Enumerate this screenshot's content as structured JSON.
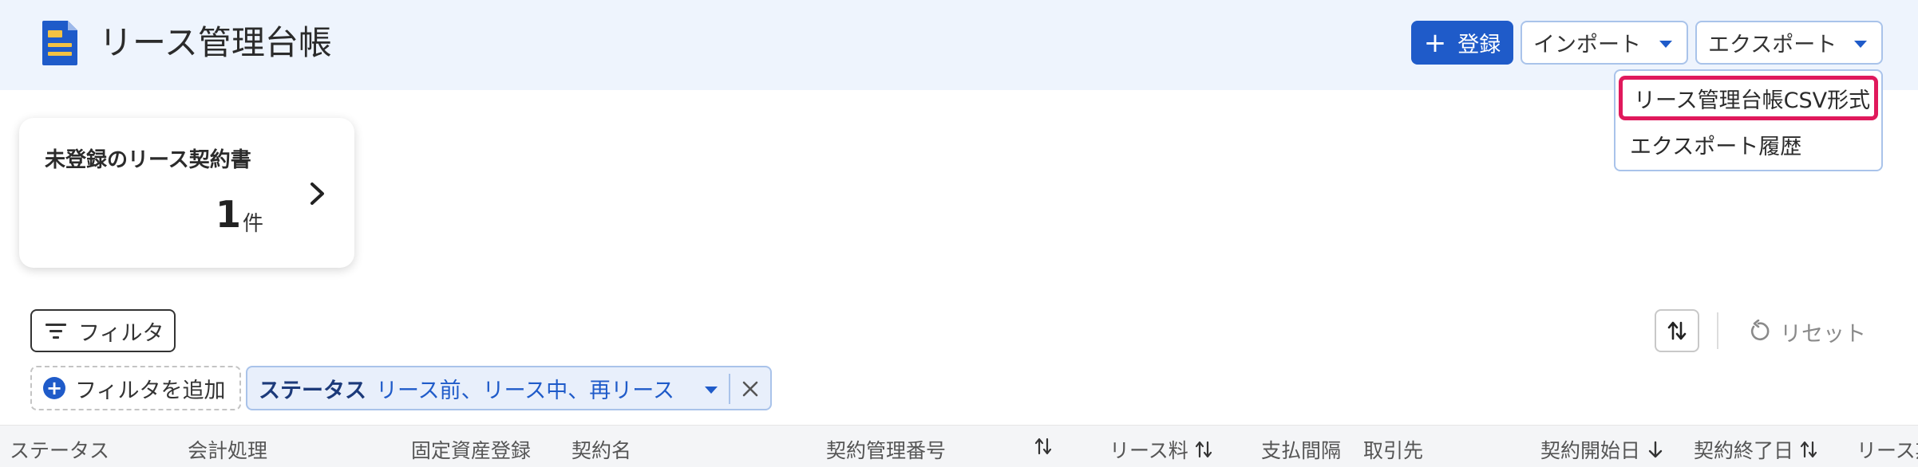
{
  "header": {
    "title": "リース管理台帳",
    "register_label": "登録",
    "import_label": "インポート",
    "export_label": "エクスポート"
  },
  "export_menu": {
    "items": [
      "リース管理台帳CSV形式",
      "エクスポート履歴"
    ]
  },
  "card": {
    "title": "未登録のリース契約書",
    "count": "1",
    "unit": "件"
  },
  "filter_bar": {
    "filter_label": "フィルタ",
    "reset_label": "リセット",
    "add_filter_label": "フィルタを追加",
    "chip_key": "ステータス",
    "chip_value": "リース前、リース中、再リース"
  },
  "table": {
    "columns": [
      "ステータス",
      "会計処理",
      "固定資産登録",
      "契約名",
      "契約管理番号",
      "リース料",
      "支払間隔",
      "取引先",
      "契約開始日",
      "契約終了日",
      "リース期"
    ]
  },
  "colors": {
    "header_bg": "#eef4fd",
    "primary": "#1f5bc9",
    "highlight": "#e0195c",
    "chip_bg": "#e8effb"
  }
}
